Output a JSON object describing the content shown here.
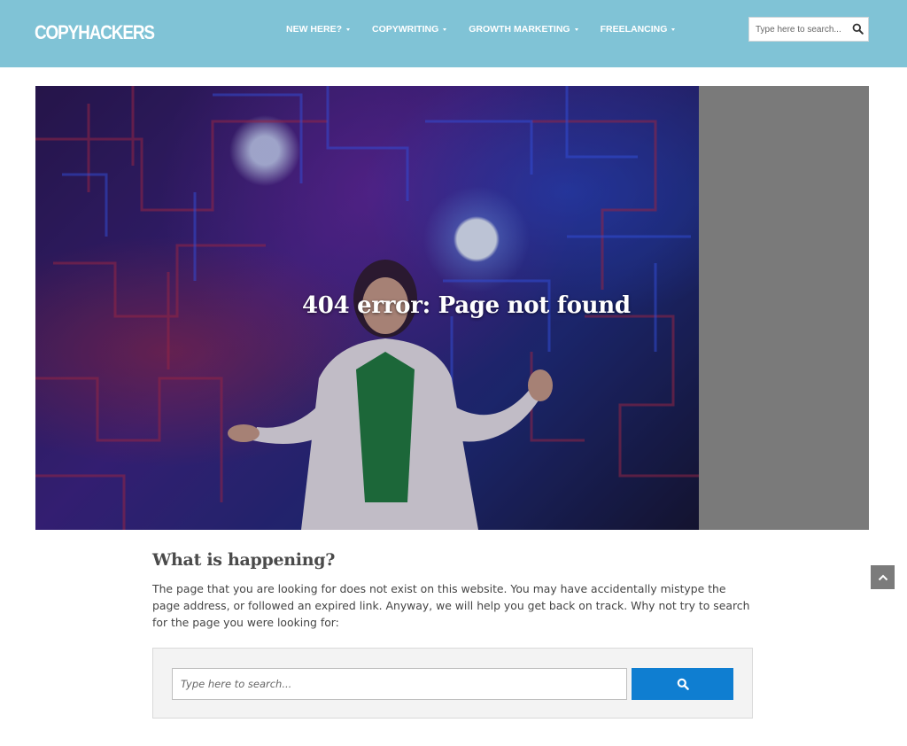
{
  "header": {
    "logo_text": "COPYHACKERS",
    "nav": [
      {
        "label": "NEW HERE?"
      },
      {
        "label": "COPYWRITING"
      },
      {
        "label": "GROWTH MARKETING"
      },
      {
        "label": "FREELANCING"
      }
    ],
    "search": {
      "placeholder": "Type here to search..."
    }
  },
  "hero": {
    "title": "404 error: Page not found"
  },
  "content": {
    "heading": "What is happening?",
    "body": "The page that you are looking for does not exist on this website. You may have accidentally mistype the page address, or followed an expired link. Anyway, we will help you get back on track. Why not try to search for the page you were looking for:",
    "search": {
      "placeholder": "Type here to search..."
    }
  },
  "icons": {
    "nav_caret": "chevron-down-icon",
    "search": "search-icon",
    "back_to_top": "chevron-up-icon"
  },
  "colors": {
    "header_bg": "#80c3d6",
    "search_button": "#0f7ed1",
    "hero_side": "#7a7a7a",
    "back_to_top": "#7b7b7b"
  }
}
